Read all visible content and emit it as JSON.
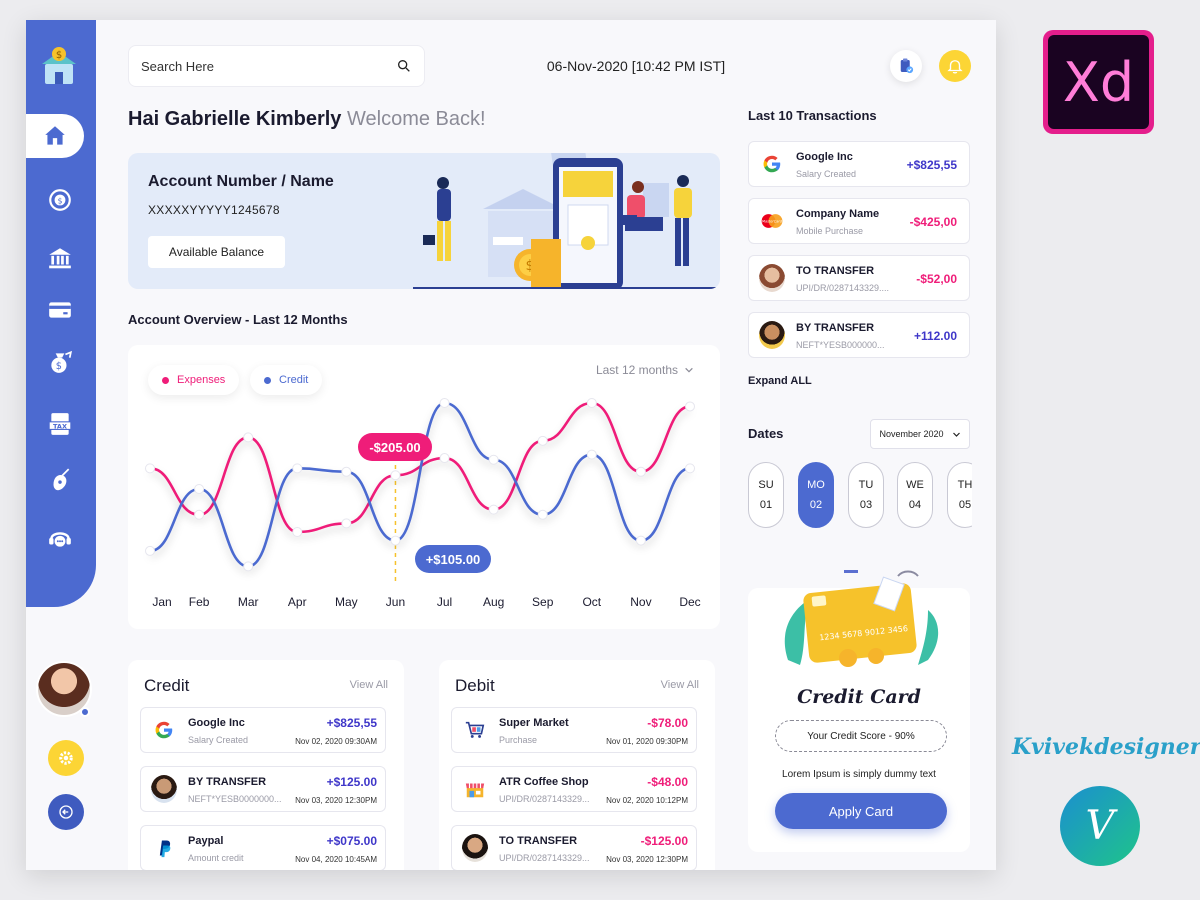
{
  "search": {
    "placeholder": "Search Here"
  },
  "header": {
    "datetime": "06-Nov-2020 [10:42 PM IST]"
  },
  "greeting": {
    "name": "Hai Gabrielle Kimberly",
    "welcome": "Welcome Back!"
  },
  "account": {
    "title": "Account Number / Name",
    "number": "XXXXXYYYYY1245678",
    "balance_button": "Available Balance"
  },
  "overview": {
    "title": "Account Overview - Last 12 Months",
    "range": "Last 12 months",
    "legend_expenses": "Expenses",
    "legend_credit": "Credit",
    "tooltip_expense": "-$205.00",
    "tooltip_credit": "+$105.00"
  },
  "chart_data": {
    "type": "line",
    "categories": [
      "Jan",
      "Feb",
      "Mar",
      "Apr",
      "May",
      "Jun",
      "Jul",
      "Aug",
      "Sep",
      "Oct",
      "Nov",
      "Dec"
    ],
    "series": [
      {
        "name": "Expenses",
        "color": "#ef1d79",
        "values": [
          0.62,
          0.35,
          0.8,
          0.25,
          0.3,
          0.58,
          0.68,
          0.38,
          0.78,
          1.0,
          0.6,
          0.98
        ]
      },
      {
        "name": "Credit",
        "color": "#4c6ad0",
        "values": [
          0.14,
          0.5,
          0.05,
          0.62,
          0.6,
          0.2,
          1.0,
          0.67,
          0.35,
          0.7,
          0.2,
          0.62
        ]
      }
    ],
    "highlight_month": "Jun",
    "grid": false,
    "legend": "top-left"
  },
  "credit_panel": {
    "title": "Credit",
    "view_all": "View All",
    "rows": [
      {
        "name": "Google Inc",
        "sub": "Salary Created",
        "amount": "+$825,55",
        "date": "Nov 02, 2020 09:30AM",
        "icon": "google-icon"
      },
      {
        "name": "BY TRANSFER",
        "sub": "NEFT*YESB0000000...",
        "amount": "+$125.00",
        "date": "Nov 03, 2020 12:30PM",
        "icon": "avatar-icon"
      },
      {
        "name": "Paypal",
        "sub": "Amount credit",
        "amount": "+$075.00",
        "date": "Nov 04, 2020 10:45AM",
        "icon": "paypal-icon"
      }
    ]
  },
  "debit_panel": {
    "title": "Debit",
    "view_all": "View All",
    "rows": [
      {
        "name": "Super Market",
        "sub": "Purchase",
        "amount": "-$78.00",
        "date": "Nov 01, 2020 09:30PM",
        "icon": "cart-icon"
      },
      {
        "name": "ATR Coffee Shop",
        "sub": "UPI/DR/0287143329...",
        "amount": "-$48.00",
        "date": "Nov 02, 2020 10:12PM",
        "icon": "shop-icon"
      },
      {
        "name": "TO TRANSFER",
        "sub": "UPI/DR/0287143329...",
        "amount": "-$125.00",
        "date": "Nov 03, 2020 12:30PM",
        "icon": "avatar-icon"
      }
    ]
  },
  "last_transactions": {
    "title": "Last 10 Transactions",
    "rows": [
      {
        "name": "Google Inc",
        "sub": "Salary Created",
        "amount": "+$825,55",
        "icon": "google-icon"
      },
      {
        "name": "Company Name",
        "sub": "Mobile Purchase",
        "amount": "-$425,00",
        "icon": "mastercard-icon",
        "logo_text": "MasterCard"
      },
      {
        "name": "TO TRANSFER",
        "sub": "UPI/DR/0287143329....",
        "amount": "-$52,00",
        "icon": "avatar-icon"
      },
      {
        "name": "BY TRANSFER",
        "sub": "NEFT*YESB000000...",
        "amount": "+112.00",
        "icon": "avatar-icon"
      }
    ],
    "expand": "Expand ALL"
  },
  "dates": {
    "title": "Dates",
    "month": "November 2020",
    "days": [
      {
        "dow": "SU",
        "num": "01"
      },
      {
        "dow": "MO",
        "num": "02"
      },
      {
        "dow": "TU",
        "num": "03"
      },
      {
        "dow": "WE",
        "num": "04"
      },
      {
        "dow": "TH",
        "num": "05"
      }
    ]
  },
  "credit_card": {
    "title": "Credit Card",
    "score": "Your Credit Score - 90%",
    "description": "Lorem Ipsum is simply dummy text",
    "apply": "Apply Card",
    "card_number": "1234  5678  9012  3456"
  },
  "branding": {
    "xd": "Xd",
    "designer": "Kvivekdesigner"
  },
  "colors": {
    "accent": "#4c6ad0",
    "pink": "#ef1d79",
    "positive": "#3f37c9",
    "negative": "#ef1d79",
    "yellow": "#fcd535"
  }
}
